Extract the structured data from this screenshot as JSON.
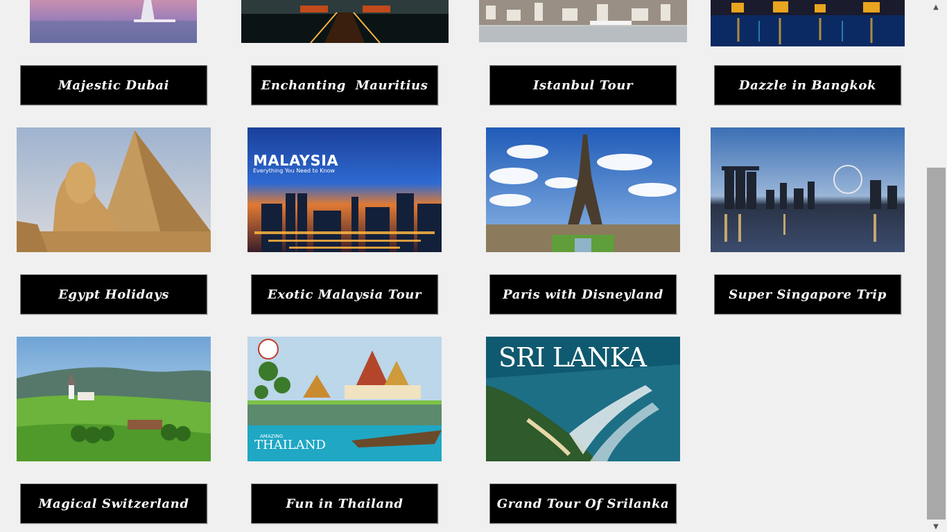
{
  "tours": [
    {
      "label": "Majestic Dubai"
    },
    {
      "label": "Enchanting  Mauritius"
    },
    {
      "label": "Istanbul Tour"
    },
    {
      "label": "Dazzle in Bangkok"
    },
    {
      "label": "Egypt Holidays"
    },
    {
      "label": "Exotic Malaysia Tour"
    },
    {
      "label": "Paris with Disneyland"
    },
    {
      "label": "Super Singapore Trip"
    },
    {
      "label": "Magical Switzerland"
    },
    {
      "label": "Fun in Thailand"
    },
    {
      "label": "Grand Tour Of Srilanka"
    }
  ],
  "image_text": {
    "malaysia_title": "MALAYSIA",
    "malaysia_sub": "Everything You Need to Know",
    "thailand_small": "AMAZING",
    "thailand_title": "THAILAND",
    "srilanka_title": "SRI LANKA"
  },
  "scrollbar": {
    "up": "▲",
    "down": "▼"
  }
}
